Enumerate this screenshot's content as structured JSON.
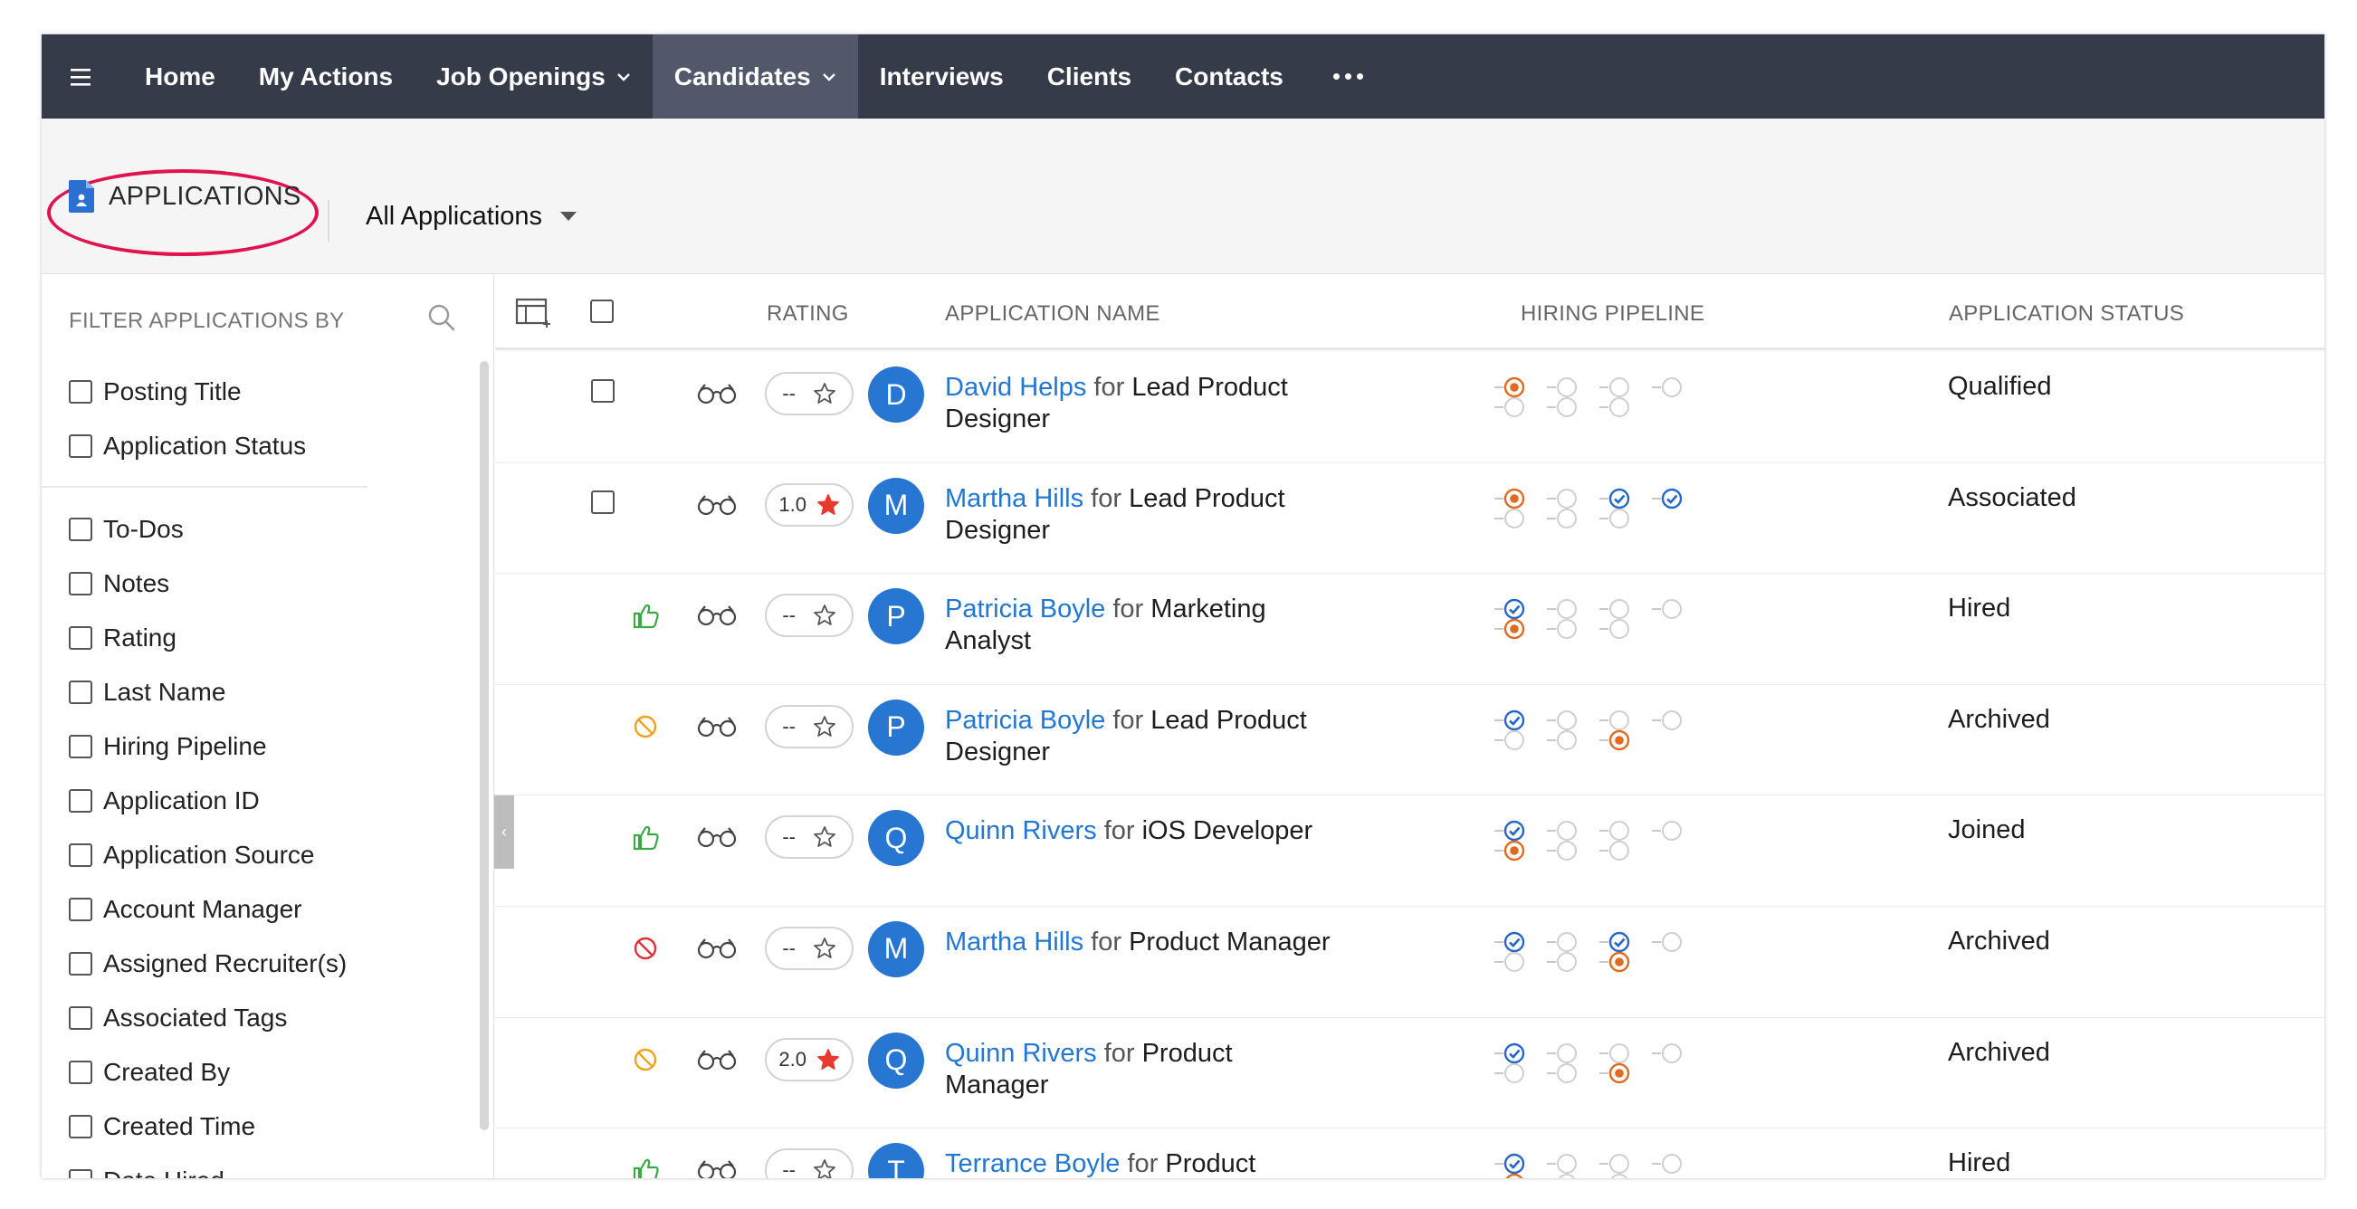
{
  "nav": {
    "items": [
      {
        "label": "Home",
        "dropdown": false,
        "active": false
      },
      {
        "label": "My Actions",
        "dropdown": false,
        "active": false
      },
      {
        "label": "Job Openings",
        "dropdown": true,
        "active": false
      },
      {
        "label": "Candidates",
        "dropdown": true,
        "active": true
      },
      {
        "label": "Interviews",
        "dropdown": false,
        "active": false
      },
      {
        "label": "Clients",
        "dropdown": false,
        "active": false
      },
      {
        "label": "Contacts",
        "dropdown": false,
        "active": false
      }
    ]
  },
  "module": {
    "title": "APPLICATIONS",
    "view": "All Applications"
  },
  "filter": {
    "heading": "FILTER APPLICATIONS BY",
    "group1": [
      "Posting Title",
      "Application Status"
    ],
    "group2": [
      "To-Dos",
      "Notes",
      "Rating",
      "Last Name",
      "Hiring Pipeline",
      "Application ID",
      "Application Source",
      "Account Manager",
      "Assigned Recruiter(s)",
      "Associated Tags",
      "Created By",
      "Created Time",
      "Date Hired"
    ]
  },
  "table": {
    "headers": {
      "rating": "RATING",
      "name": "APPLICATION NAME",
      "pipeline": "HIRING PIPELINE",
      "status": "APPLICATION STATUS"
    },
    "for_word": "for",
    "rows": [
      {
        "feedback": "checkbox",
        "rating": "--",
        "rated": false,
        "initial": "D",
        "candidate": "David Helps",
        "job": "Lead Product Designer",
        "status": "Qualified",
        "pipeline": {
          "top": [
            "orange",
            "empty",
            "empty",
            "empty"
          ],
          "bottom": [
            "empty",
            "empty",
            "empty"
          ]
        }
      },
      {
        "feedback": "checkbox",
        "rating": "1.0",
        "rated": true,
        "initial": "M",
        "candidate": "Martha Hills",
        "job": "Lead Product Designer",
        "status": "Associated",
        "pipeline": {
          "top": [
            "orange",
            "empty",
            "blue",
            "blue"
          ],
          "bottom": [
            "empty",
            "empty",
            "empty"
          ]
        }
      },
      {
        "feedback": "thumbs-up",
        "rating": "--",
        "rated": false,
        "initial": "P",
        "candidate": "Patricia Boyle",
        "job": "Marketing Analyst",
        "status": "Hired",
        "pipeline": {
          "top": [
            "blue",
            "empty",
            "empty",
            "empty"
          ],
          "bottom": [
            "orange",
            "empty",
            "empty"
          ]
        }
      },
      {
        "feedback": "block-yellow",
        "rating": "--",
        "rated": false,
        "initial": "P",
        "candidate": "Patricia Boyle",
        "job": "Lead Product Designer",
        "status": "Archived",
        "pipeline": {
          "top": [
            "blue",
            "empty",
            "empty",
            "empty"
          ],
          "bottom": [
            "empty",
            "empty",
            "orange"
          ]
        }
      },
      {
        "feedback": "thumbs-up",
        "rating": "--",
        "rated": false,
        "initial": "Q",
        "candidate": "Quinn Rivers",
        "job": "iOS Developer",
        "status": "Joined",
        "pipeline": {
          "top": [
            "blue",
            "empty",
            "empty",
            "empty"
          ],
          "bottom": [
            "orange",
            "empty",
            "empty"
          ]
        }
      },
      {
        "feedback": "block-red",
        "rating": "--",
        "rated": false,
        "initial": "M",
        "candidate": "Martha Hills",
        "job": "Product Manager",
        "status": "Archived",
        "pipeline": {
          "top": [
            "blue",
            "empty",
            "blue",
            "empty"
          ],
          "bottom": [
            "empty",
            "empty",
            "orange"
          ]
        }
      },
      {
        "feedback": "block-yellow",
        "rating": "2.0",
        "rated": true,
        "initial": "Q",
        "candidate": "Quinn Rivers",
        "job": "Product Manager",
        "status": "Archived",
        "pipeline": {
          "top": [
            "blue",
            "empty",
            "empty",
            "empty"
          ],
          "bottom": [
            "empty",
            "empty",
            "orange"
          ]
        }
      },
      {
        "feedback": "thumbs-up",
        "rating": "--",
        "rated": false,
        "initial": "T",
        "candidate": "Terrance Boyle",
        "job": "Product Manager",
        "status": "Hired",
        "pipeline": {
          "top": [
            "blue",
            "empty",
            "empty",
            "empty"
          ],
          "bottom": [
            "orange",
            "empty",
            "empty"
          ]
        }
      }
    ]
  },
  "colors": {
    "nav_bg": "#353b48",
    "nav_active": "#50586a",
    "link": "#2277d2",
    "avatar": "#2777d2",
    "orange": "#e06a1f",
    "blue": "#2466c9",
    "highlight": "#e0134f",
    "thumb": "#3aaa45",
    "block_yellow": "#f0a21a",
    "block_red": "#e0303a",
    "star_red": "#e63a2e"
  }
}
